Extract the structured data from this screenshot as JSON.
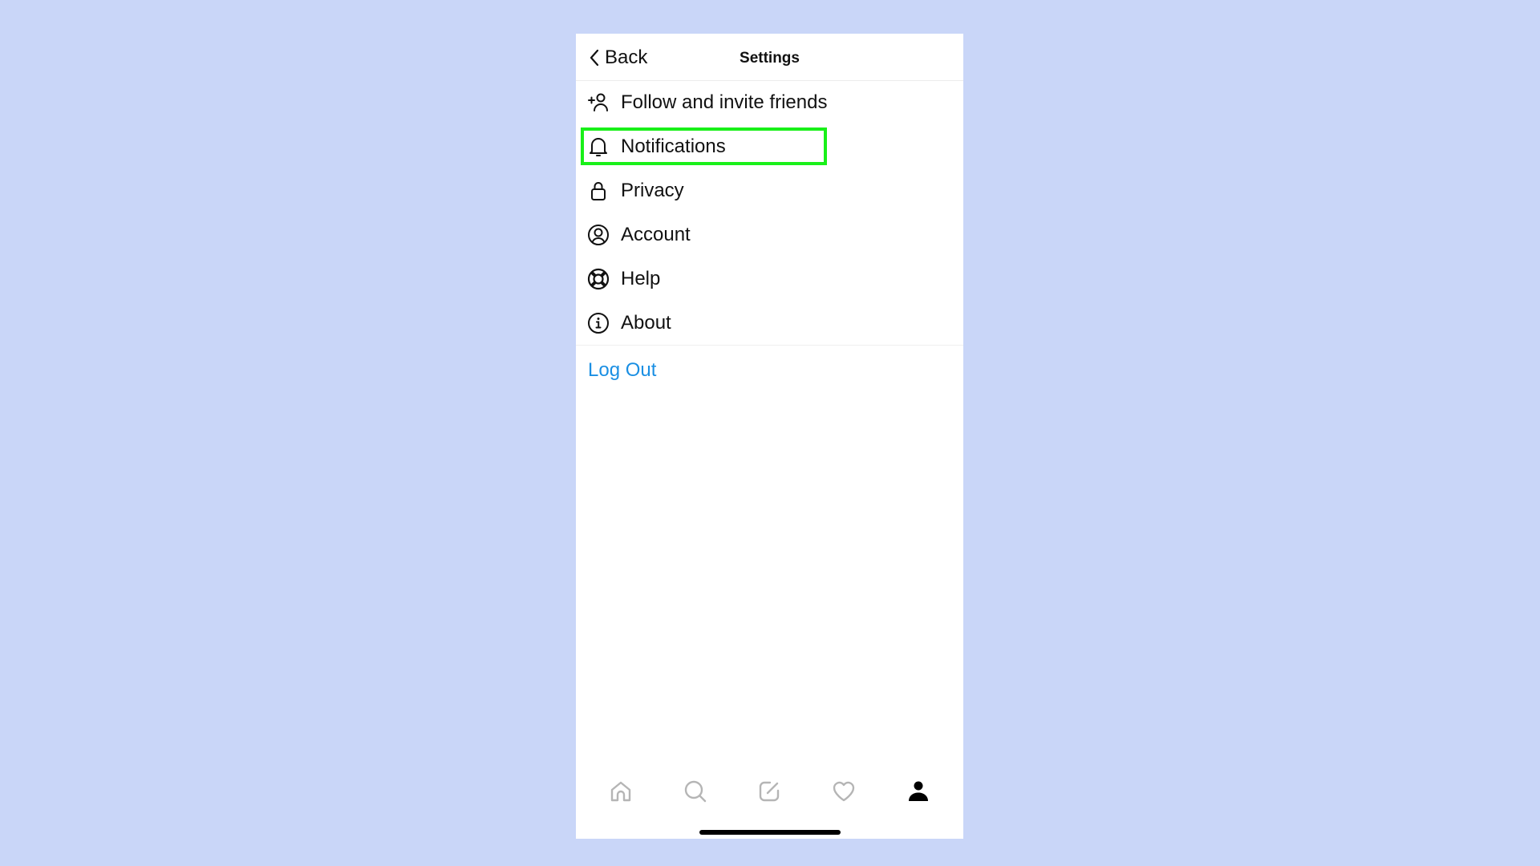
{
  "nav": {
    "back_label": "Back",
    "title": "Settings"
  },
  "menu": {
    "items": [
      {
        "label": "Follow and invite friends",
        "icon": "add-person-icon"
      },
      {
        "label": "Notifications",
        "icon": "bell-icon",
        "highlighted": true
      },
      {
        "label": "Privacy",
        "icon": "lock-icon"
      },
      {
        "label": "Account",
        "icon": "account-circle-icon"
      },
      {
        "label": "Help",
        "icon": "lifebuoy-icon"
      },
      {
        "label": "About",
        "icon": "info-icon"
      }
    ]
  },
  "logout_label": "Log Out",
  "tabbar": {
    "tabs": [
      {
        "name": "home",
        "icon": "home-icon",
        "active": false
      },
      {
        "name": "search",
        "icon": "search-icon",
        "active": false
      },
      {
        "name": "compose",
        "icon": "compose-icon",
        "active": false
      },
      {
        "name": "activity",
        "icon": "heart-icon",
        "active": false
      },
      {
        "name": "profile",
        "icon": "person-icon",
        "active": true
      }
    ]
  },
  "colors": {
    "background": "#c9d6f8",
    "highlight": "#19f019",
    "link": "#1a8fe3",
    "inactive_tab": "#b5b5b5",
    "active_tab": "#000000"
  }
}
